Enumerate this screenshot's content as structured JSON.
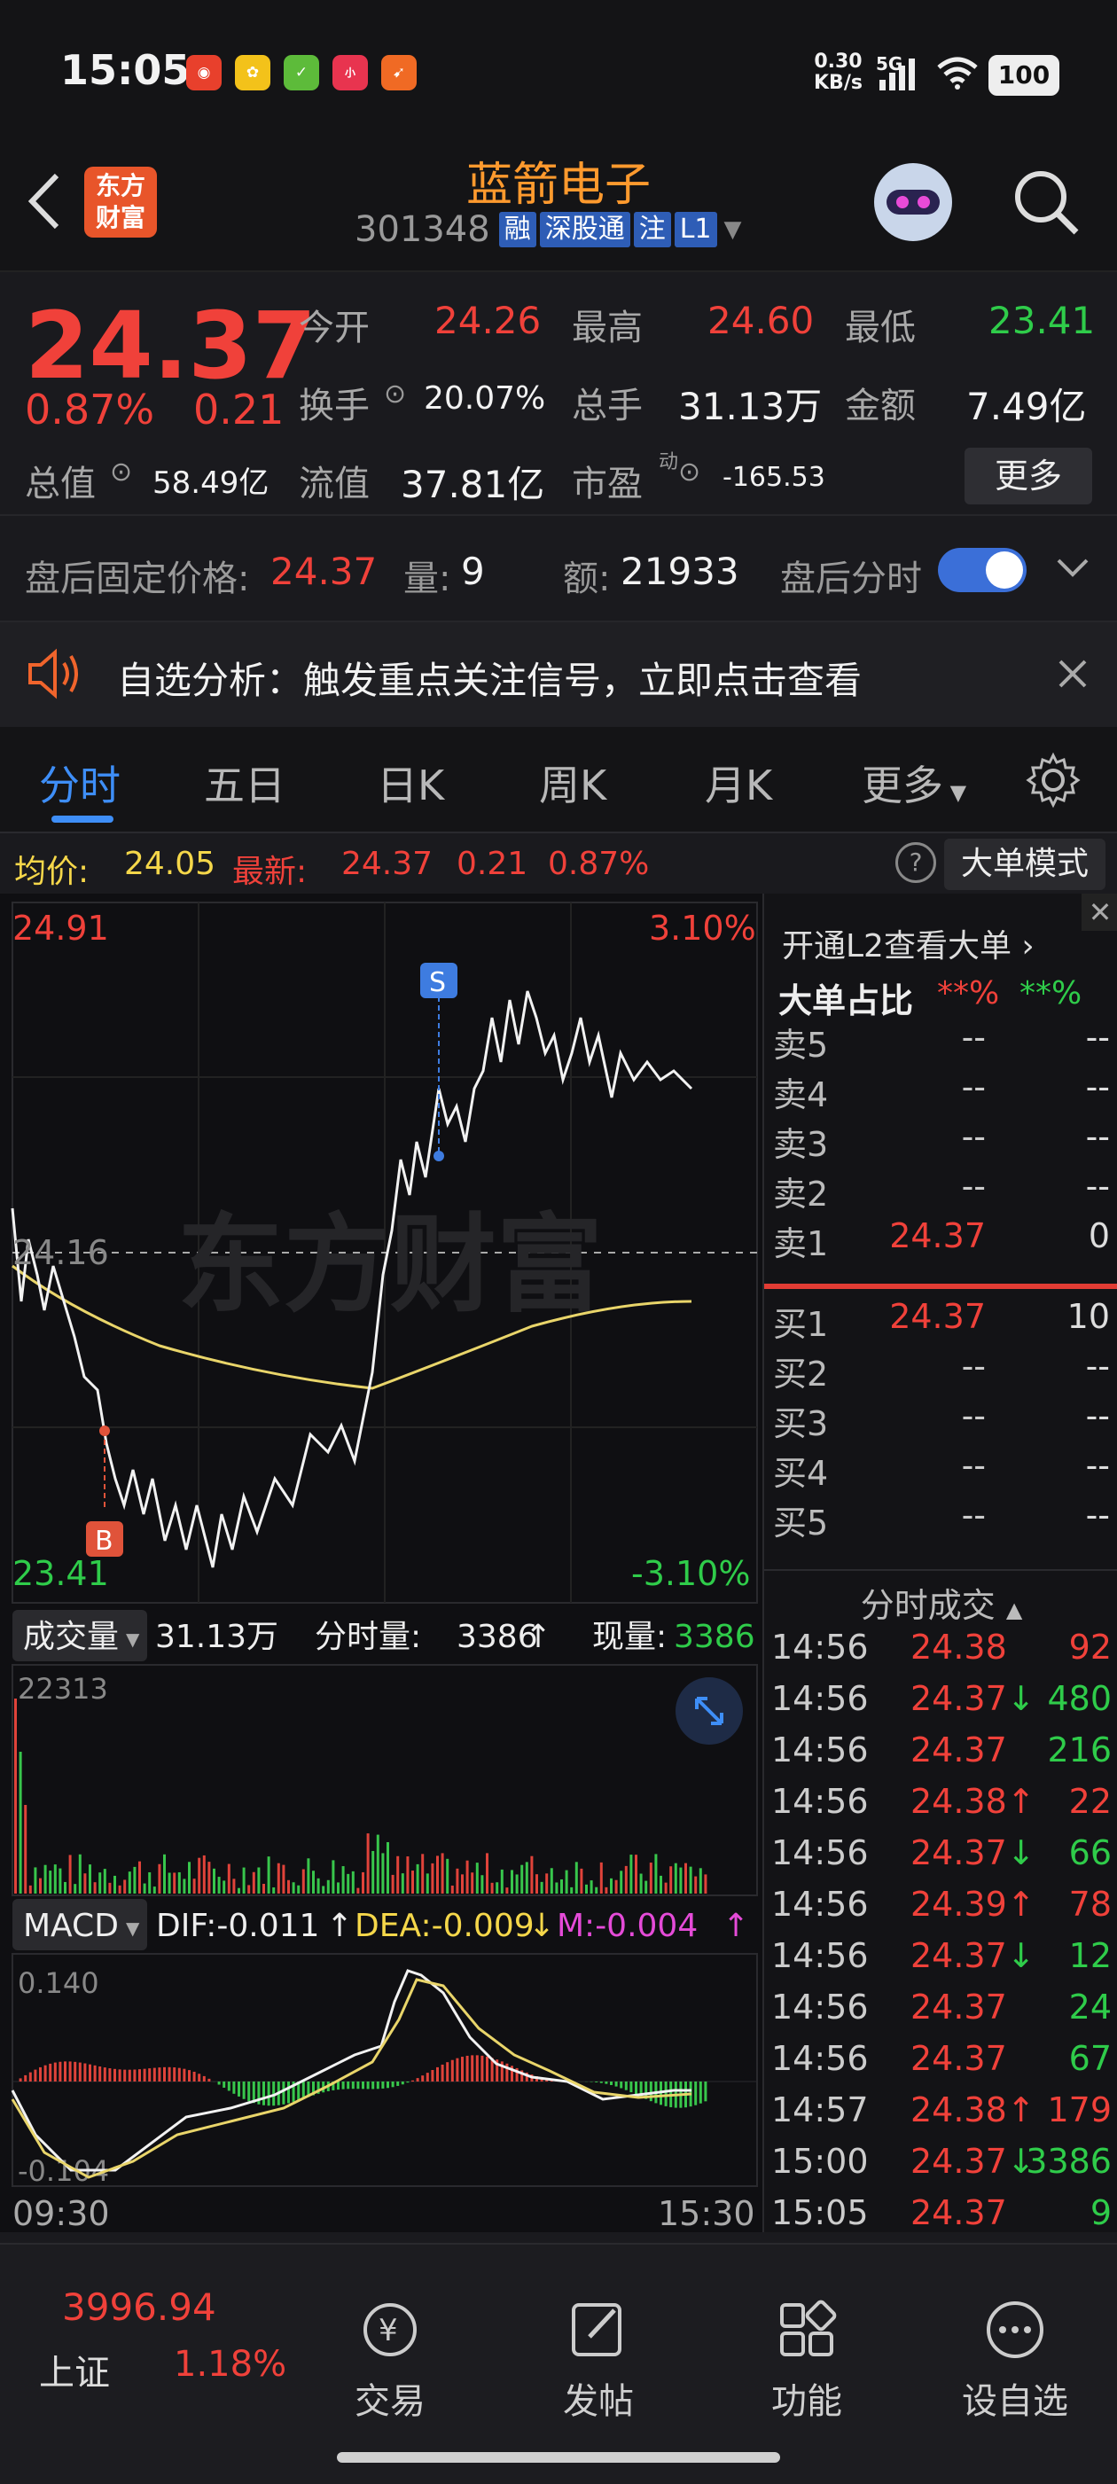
{
  "status_bar": {
    "time": "15:05",
    "net_speed_value": "0.30",
    "net_speed_unit": "KB/s",
    "signal": "5G",
    "battery": "100"
  },
  "header": {
    "title": "蓝箭电子",
    "code": "301348",
    "tags": [
      "融",
      "深股通",
      "注",
      "L1"
    ],
    "logo_line1": "东方",
    "logo_line2": "财富"
  },
  "quote": {
    "price": "24.37",
    "change_pct": "0.87%",
    "change": "0.21",
    "open_label": "今开",
    "open": "24.26",
    "high_label": "最高",
    "high": "24.60",
    "low_label": "最低",
    "low": "23.41",
    "turnover_label": "换手",
    "turnover": "20.07%",
    "volume_label": "总手",
    "volume": "31.13万",
    "amount_label": "金额",
    "amount": "7.49亿",
    "mktcap_label": "总值",
    "mktcap": "58.49亿",
    "float_label": "流值",
    "float_cap": "37.81亿",
    "pe_label": "市盈",
    "pe_sup": "动",
    "pe": "-165.53",
    "more_button": "更多"
  },
  "after_hours": {
    "price_label": "盘后固定价格:",
    "price": "24.37",
    "vol_label": "量:",
    "vol": "9",
    "amt_label": "额:",
    "amt": "21933",
    "toggle_label": "盘后分时",
    "toggle_on": true
  },
  "banner": {
    "text": "自选分析：触发重点关注信号，立即点击查看"
  },
  "tabs": [
    "分时",
    "五日",
    "日K",
    "周K",
    "月K",
    "更多"
  ],
  "active_tab": "分时",
  "info_bar": {
    "avg_label": "均价:",
    "avg": "24.05",
    "latest_label": "最新:",
    "latest": "24.37",
    "change": "0.21",
    "change_pct": "0.87%",
    "mode_button": "大单模式"
  },
  "chart": {
    "y_max": "24.91",
    "y_min": "23.41",
    "y_mid": "24.16",
    "pct_max": "3.10%",
    "pct_min": "-3.10%",
    "marker_buy": "B",
    "marker_sell": "S",
    "watermark": "东方财富",
    "volume_label": "成交量",
    "volume_total": "31.13万",
    "fenshi_label": "分时量:",
    "fenshi_value": "3386",
    "current_label": "现量:",
    "current_value": "3386",
    "vol_max": "22313",
    "macd_label": "MACD",
    "dif": "DIF:-0.011",
    "dea": "DEA:-0.009",
    "m": "M:-0.004",
    "macd_max": "0.140",
    "macd_min": "-0.104",
    "time_start": "09:30",
    "time_end": "15:30"
  },
  "side_panel": {
    "l2_link": "开通L2查看大单",
    "big_order_label": "大单占比",
    "big_order_red": "**%",
    "big_order_green": "**%",
    "asks": [
      {
        "label": "卖5",
        "price": "--",
        "qty": "--"
      },
      {
        "label": "卖4",
        "price": "--",
        "qty": "--"
      },
      {
        "label": "卖3",
        "price": "--",
        "qty": "--"
      },
      {
        "label": "卖2",
        "price": "--",
        "qty": "--"
      },
      {
        "label": "卖1",
        "price": "24.37",
        "qty": "0"
      }
    ],
    "bids": [
      {
        "label": "买1",
        "price": "24.37",
        "qty": "10"
      },
      {
        "label": "买2",
        "price": "--",
        "qty": "--"
      },
      {
        "label": "买3",
        "price": "--",
        "qty": "--"
      },
      {
        "label": "买4",
        "price": "--",
        "qty": "--"
      },
      {
        "label": "买5",
        "price": "--",
        "qty": "--"
      }
    ],
    "ticks_label": "分时成交",
    "ticks": [
      {
        "time": "14:56",
        "price": "24.38",
        "dir": "",
        "vol": "92",
        "vcolor": "red"
      },
      {
        "time": "14:56",
        "price": "24.37",
        "dir": "↓",
        "vol": "480",
        "vcolor": "green"
      },
      {
        "time": "14:56",
        "price": "24.37",
        "dir": "",
        "vol": "216",
        "vcolor": "green"
      },
      {
        "time": "14:56",
        "price": "24.38",
        "dir": "↑",
        "vol": "22",
        "vcolor": "red"
      },
      {
        "time": "14:56",
        "price": "24.37",
        "dir": "↓",
        "vol": "66",
        "vcolor": "green"
      },
      {
        "time": "14:56",
        "price": "24.39",
        "dir": "↑",
        "vol": "78",
        "vcolor": "red"
      },
      {
        "time": "14:56",
        "price": "24.37",
        "dir": "↓",
        "vol": "12",
        "vcolor": "green"
      },
      {
        "time": "14:56",
        "price": "24.37",
        "dir": "",
        "vol": "24",
        "vcolor": "green"
      },
      {
        "time": "14:56",
        "price": "24.37",
        "dir": "",
        "vol": "67",
        "vcolor": "green"
      },
      {
        "time": "14:57",
        "price": "24.38",
        "dir": "↑",
        "vol": "179",
        "vcolor": "red"
      },
      {
        "time": "15:00",
        "price": "24.37",
        "dir": "↓",
        "vol": "3386",
        "vcolor": "green"
      },
      {
        "time": "15:05",
        "price": "24.37",
        "dir": "",
        "vol": "9",
        "vcolor": "green"
      }
    ]
  },
  "bottom_nav": {
    "index_value": "3996.94",
    "index_name": "上证",
    "index_change": "1.18%",
    "items": [
      "交易",
      "发帖",
      "功能",
      "设自选"
    ]
  }
}
